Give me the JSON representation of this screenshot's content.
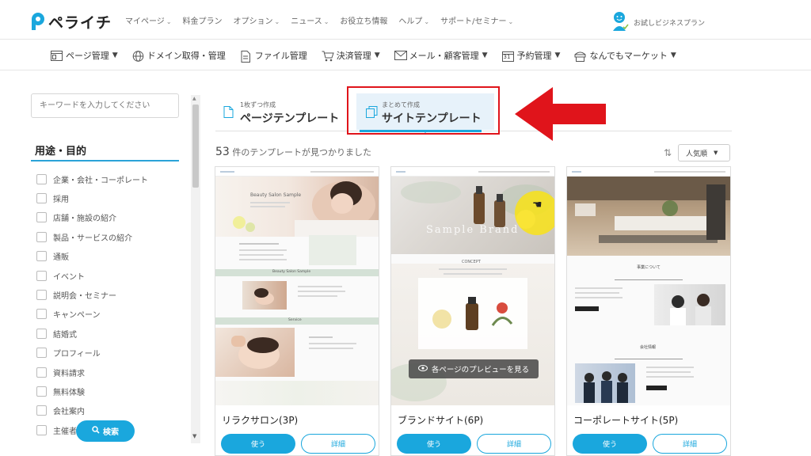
{
  "header": {
    "logo_text": "ペライチ",
    "nav": [
      {
        "label": "マイページ",
        "has_caret": true
      },
      {
        "label": "料金プラン",
        "has_caret": false
      },
      {
        "label": "オプション",
        "has_caret": true
      },
      {
        "label": "ニュース",
        "has_caret": true
      },
      {
        "label": "お役立ち情報",
        "has_caret": false
      },
      {
        "label": "ヘルプ",
        "has_caret": true
      },
      {
        "label": "サポート/セミナー",
        "has_caret": true
      }
    ],
    "account_label": "お試しビジネスプラン"
  },
  "subnav": [
    {
      "label": "ページ管理",
      "icon": "page-manage-icon",
      "has_chevron": true
    },
    {
      "label": "ドメイン取得・管理",
      "icon": "globe-icon",
      "has_chevron": false
    },
    {
      "label": "ファイル管理",
      "icon": "file-icon",
      "has_chevron": false
    },
    {
      "label": "決済管理",
      "icon": "cart-icon",
      "has_chevron": true
    },
    {
      "label": "メール・顧客管理",
      "icon": "mail-icon",
      "has_chevron": true
    },
    {
      "label": "予約管理",
      "icon": "calendar-icon",
      "calendar_day": "31",
      "has_chevron": true
    },
    {
      "label": "なんでもマーケット",
      "icon": "market-icon",
      "has_chevron": true
    }
  ],
  "sidebar": {
    "search_placeholder": "キーワードを入力してください",
    "category_heading": "用途・目的",
    "categories": [
      "企業・会社・コーポレート",
      "採用",
      "店舗・施設の紹介",
      "製品・サービスの紹介",
      "通販",
      "イベント",
      "説明会・セミナー",
      "キャンペーン",
      "結婚式",
      "プロフィール",
      "資料請求",
      "無料体験",
      "会社案内",
      "主催者"
    ],
    "search_button": "検索"
  },
  "tabs": [
    {
      "small": "1枚ずつ作成",
      "big": "ページテンプレート",
      "active": false
    },
    {
      "small": "まとめて作成",
      "big": "サイトテンプレート",
      "active": true
    }
  ],
  "results": {
    "count": "53",
    "count_suffix": "件のテンプレートが見つかりました",
    "sort_label": "人気順"
  },
  "cards": [
    {
      "title": "リラクサロン(3P)",
      "use_label": "使う",
      "detail_label": "詳細",
      "preview_texts": [
        "Beauty Salon Sample",
        "Beauty Salon Sample",
        "Service"
      ]
    },
    {
      "title": "ブランドサイト(6P)",
      "use_label": "使う",
      "detail_label": "詳細",
      "preview_texts": [
        "Sample Brand",
        "CONCEPT"
      ],
      "overlay_label": "各ページのプレビューを見る"
    },
    {
      "title": "コーポレートサイト(5P)",
      "use_label": "使う",
      "detail_label": "詳細",
      "preview_texts": [
        "事業について",
        "会社情報"
      ]
    }
  ],
  "colors": {
    "accent": "#1aa7dd",
    "highlight": "#e0141b"
  }
}
